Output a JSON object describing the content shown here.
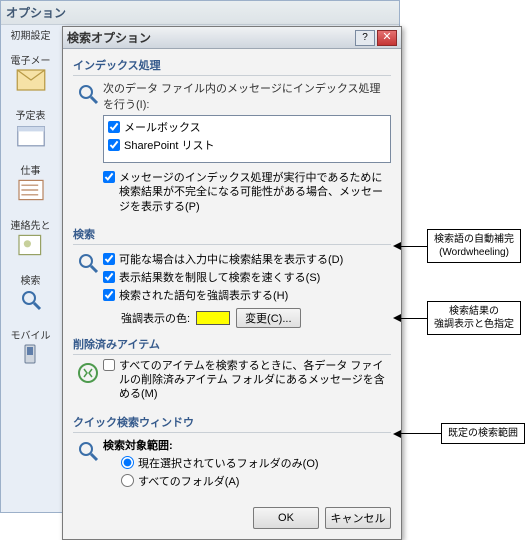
{
  "parent_window": {
    "title": "オプション",
    "sidebar": [
      {
        "label": "初期設定",
        "icon": "prefs-icon"
      },
      {
        "label": "電子メー",
        "icon": "mail-icon"
      },
      {
        "label": "予定表",
        "icon": "calendar-icon"
      },
      {
        "label": "仕事",
        "icon": "tasks-icon"
      },
      {
        "label": "連絡先と",
        "icon": "contacts-icon"
      },
      {
        "label": "検索",
        "icon": "search-icon"
      },
      {
        "label": "モバイル",
        "icon": "mobile-icon"
      }
    ]
  },
  "dialog": {
    "title": "検索オプション",
    "groups": {
      "indexing": {
        "title": "インデックス処理",
        "label": "次のデータ ファイル内のメッセージにインデックス処理を行う(I):",
        "items": [
          {
            "checked": true,
            "text": "メールボックス"
          },
          {
            "checked": true,
            "text": "SharePoint リスト"
          }
        ],
        "prompt_checked": true,
        "prompt": "メッセージのインデックス処理が実行中であるために検索結果が不完全になる可能性がある場合、メッセージを表示する(P)"
      },
      "search": {
        "title": "検索",
        "auto_checked": true,
        "auto": "可能な場合は入力中に検索結果を表示する(D)",
        "limit_checked": true,
        "limit": "表示結果数を制限して検索を速くする(S)",
        "hilite_checked": true,
        "hilite": "検索された語句を強調表示する(H)",
        "color_label": "強調表示の色:",
        "color_hex": "#ffff00",
        "change_btn": "変更(C)..."
      },
      "deleted": {
        "title": "削除済みアイテム",
        "include_checked": false,
        "include": "すべてのアイテムを検索するときに、各データ ファイルの削除済みアイテム フォルダにあるメッセージを含める(M)"
      },
      "quick": {
        "title": "クイック検索ウィンドウ",
        "scope_label": "検索対象範囲:",
        "r1_selected": true,
        "r1": "現在選択されているフォルダのみ(O)",
        "r2_selected": false,
        "r2": "すべてのフォルダ(A)"
      }
    },
    "buttons": {
      "ok": "OK",
      "cancel": "キャンセル"
    }
  },
  "annotations": {
    "wordwheel": "検索語の自動補完\n(Wordwheeling)",
    "highlight": "検索結果の\n強調表示と色指定",
    "scope": "既定の検索範囲"
  }
}
